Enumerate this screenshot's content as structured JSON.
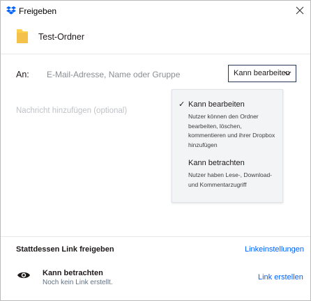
{
  "window": {
    "title": "Freigeben",
    "brand_color": "#0061fe",
    "close_icon": "close-icon",
    "logo_icon": "dropbox-logo-icon"
  },
  "folder": {
    "name": "Test-Ordner",
    "icon": "folder-icon",
    "icon_color": "#fdcf4e"
  },
  "share": {
    "to_label": "An:",
    "input_placeholder": "E-Mail-Adresse, Name oder Gruppe",
    "input_value": "",
    "permission_selected": "Kann bearbeiten",
    "message_placeholder": "Nachricht hinzufügen (optional)"
  },
  "permission_menu": {
    "items": [
      {
        "title": "Kann bearbeiten",
        "selected": true,
        "description": "Nutzer können den Ordner bearbeiten, löschen, kommentieren und ihrer Dropbox hinzufügen"
      },
      {
        "title": "Kann betrachten",
        "selected": false,
        "description": "Nutzer haben Lese-, Download- und Kommentarzugriff"
      }
    ],
    "checkmark": "✓"
  },
  "link_section": {
    "heading": "Stattdessen Link freigeben",
    "settings_link": "Linkeinstellungen",
    "access_title": "Kann betrachten",
    "access_status": "Noch kein Link erstellt.",
    "create_link": "Link erstellen",
    "icon": "eye-icon"
  }
}
